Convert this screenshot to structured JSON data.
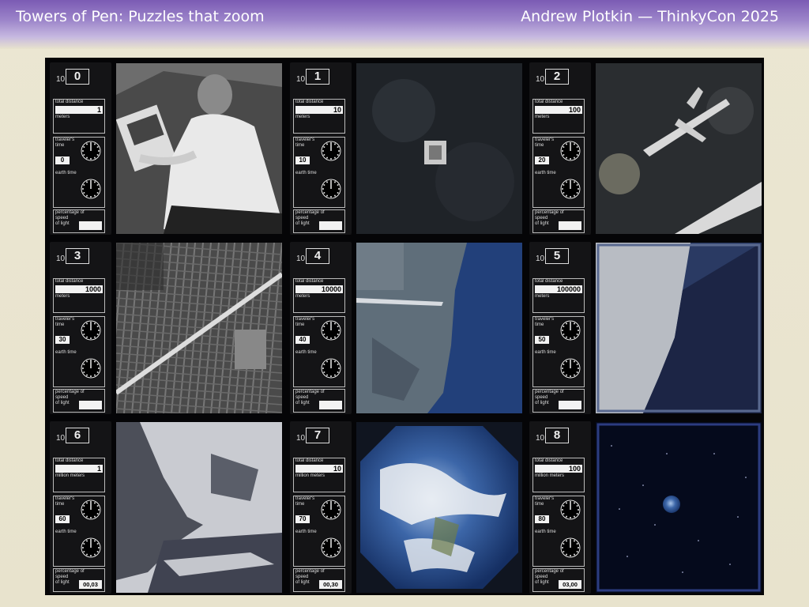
{
  "slide": {
    "title": "Towers of Pen: Puzzles that zoom",
    "byline": "Andrew Plotkin — ThinkyCon 2025"
  },
  "panel_labels": {
    "base": "10",
    "total_distance": "total distance",
    "travelers_time_1": "traveler's",
    "travelers_time_2": "time",
    "earth_time": "earth time",
    "percentage_1": "percentage of",
    "percentage_2": "speed",
    "percentage_3": "of light"
  },
  "panels": [
    {
      "exponent": "0",
      "distance": "1",
      "unit": "meters",
      "traveler_time": "0",
      "percentage": "",
      "image": "man-on-blanket-photo"
    },
    {
      "exponent": "1",
      "distance": "10",
      "unit": "meters",
      "traveler_time": "10",
      "percentage": "",
      "image": "park-aerial-photo"
    },
    {
      "exponent": "2",
      "distance": "100",
      "unit": "meters",
      "traveler_time": "20",
      "percentage": "",
      "image": "airplane-lakefront-aerial-photo"
    },
    {
      "exponent": "3",
      "distance": "1000",
      "unit": "meters",
      "traveler_time": "30",
      "percentage": "",
      "image": "city-grid-aerial-photo"
    },
    {
      "exponent": "4",
      "distance": "10000",
      "unit": "meters",
      "traveler_time": "40",
      "percentage": "",
      "image": "lake-shoreline-photo"
    },
    {
      "exponent": "5",
      "distance": "100000",
      "unit": "meters",
      "traveler_time": "50",
      "percentage": "",
      "image": "lake-region-photo"
    },
    {
      "exponent": "6",
      "distance": "1",
      "unit": "million meters",
      "traveler_time": "60",
      "percentage": "00,03",
      "image": "great-lakes-photo"
    },
    {
      "exponent": "7",
      "distance": "10",
      "unit": "million meters",
      "traveler_time": "70",
      "percentage": "00,30",
      "image": "earth-photo"
    },
    {
      "exponent": "8",
      "distance": "100",
      "unit": "million meters",
      "traveler_time": "80",
      "percentage": "03,00",
      "image": "earth-in-space-photo"
    }
  ],
  "colors": {
    "banner_top": "#7b5bb4",
    "background": "#e8e3cd",
    "figure_bg": "#050507"
  }
}
